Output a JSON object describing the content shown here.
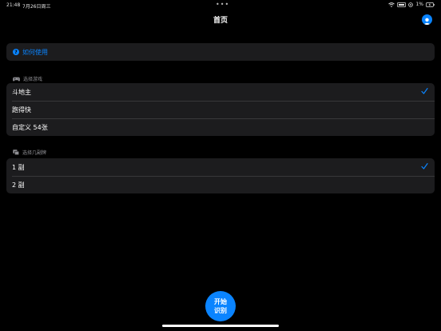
{
  "status_bar": {
    "time": "21:48",
    "date": "7月26日周三",
    "battery": "1%"
  },
  "nav": {
    "title": "首页",
    "avatar_icon": "person-circle-icon"
  },
  "help": {
    "icon": "question-circle-icon",
    "label": "如何使用"
  },
  "game_section": {
    "header": "选择游戏",
    "icon": "gamecontroller-icon",
    "items": [
      {
        "label": "斗地主",
        "selected": true
      },
      {
        "label": "跑得快",
        "selected": false
      },
      {
        "label": "自定义 54张",
        "selected": false
      }
    ]
  },
  "deck_section": {
    "header": "选择几副牌",
    "icon": "cards-stack-icon",
    "items": [
      {
        "label": "1 副",
        "selected": true
      },
      {
        "label": "2 副",
        "selected": false
      }
    ]
  },
  "start_button": {
    "line1": "开始",
    "line2": "识别"
  },
  "colors": {
    "accent": "#0a84ff",
    "background": "#000000",
    "card": "#1c1c1e",
    "secondary_text": "#8e8e93"
  }
}
